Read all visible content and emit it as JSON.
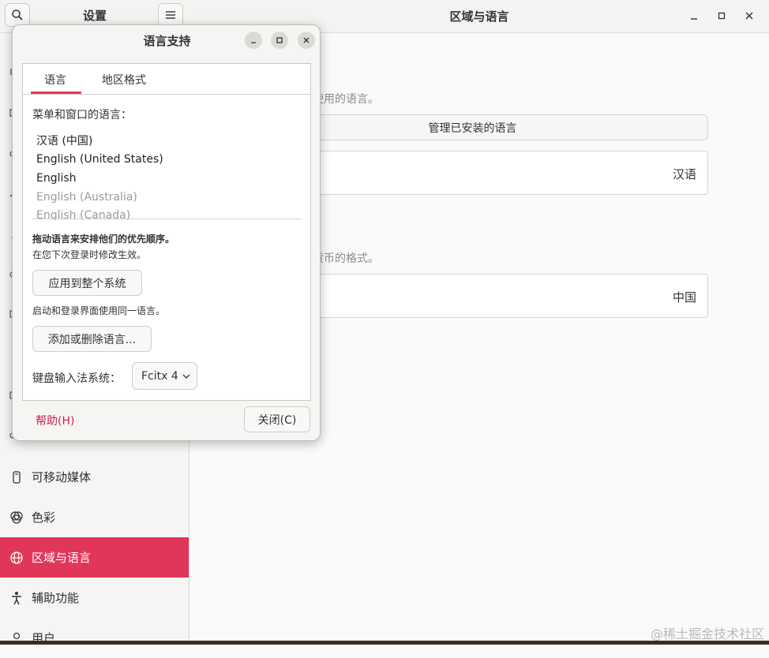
{
  "sidebar": {
    "title": "设置",
    "items": [
      {
        "label": "可移动媒体",
        "icon": "removable-media-icon"
      },
      {
        "label": "色彩",
        "icon": "color-icon"
      },
      {
        "label": "区域与语言",
        "icon": "globe-icon"
      },
      {
        "label": "辅助功能",
        "icon": "accessibility-icon"
      },
      {
        "label": "用户",
        "icon": "user-icon"
      }
    ]
  },
  "main": {
    "title": "区域与语言",
    "language_desc": "使用的语言。",
    "manage_button": "管理已安装的语言",
    "language_value": "汉语",
    "formats_desc": "货币的格式。",
    "formats_value": "中国"
  },
  "dialog": {
    "title": "语言支持",
    "tabs": [
      "语言",
      "地区格式"
    ],
    "menu_lang_label": "菜单和窗口的语言：",
    "languages": [
      {
        "label": "汉语 (中国)",
        "dim": false
      },
      {
        "label": "English (United States)",
        "dim": false
      },
      {
        "label": "English",
        "dim": false
      },
      {
        "label": "English (Australia)",
        "dim": true
      },
      {
        "label": "English (Canada)",
        "dim": true
      }
    ],
    "drag_hint": "拖动语言来安排他们的优先顺序。",
    "next_login_hint": "在您下次登录时修改生效。",
    "apply_system_button": "应用到整个系统",
    "apply_hint": "启动和登录界面使用同一语言。",
    "add_remove_button": "添加或删除语言...",
    "keyboard_label": "键盘输入法系统：",
    "keyboard_value": "Fcitx 4",
    "help_link": "帮助(H)",
    "close_button": "关闭(C)"
  },
  "watermark": "@稀土掘金技术社区",
  "colors": {
    "accent": "#e0365a",
    "link": "#c7254e"
  }
}
